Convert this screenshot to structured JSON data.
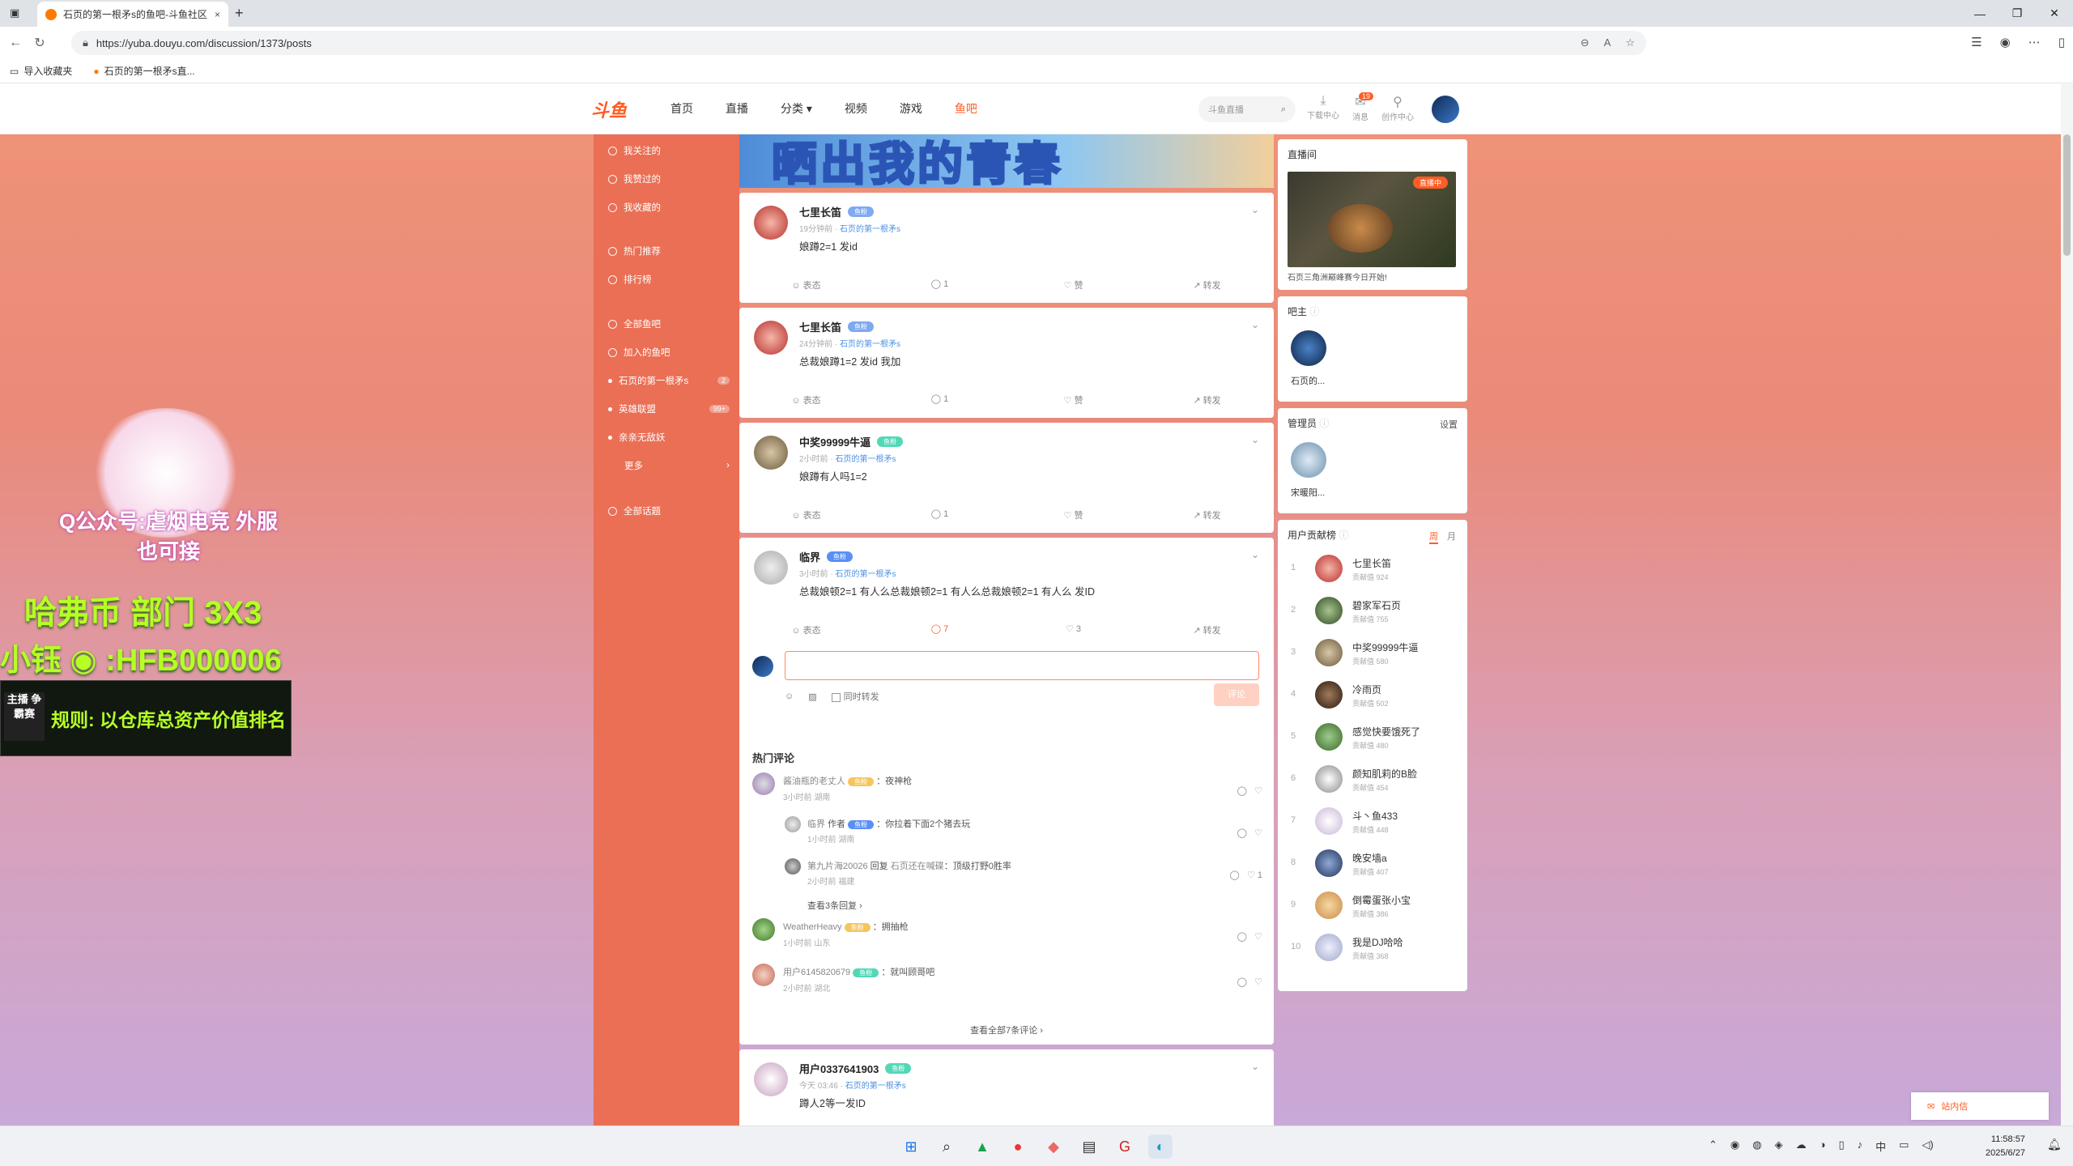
{
  "browser": {
    "tab_title": "石页的第一根矛s的鱼吧-斗鱼社区",
    "tab_close": "×",
    "new_tab": "+",
    "url": "https://yuba.douyu.com/discussion/1373/posts",
    "bookmarks": [
      "导入收藏夹",
      "石页的第一根矛s直..."
    ]
  },
  "topnav": {
    "logo": "斗鱼",
    "links": [
      "首页",
      "直播",
      "分类",
      "视频",
      "游戏",
      "鱼吧"
    ],
    "search_placeholder": "斗鱼直播",
    "icons": [
      {
        "icon": "download-icon",
        "label": "下载中心"
      },
      {
        "icon": "message-icon",
        "label": "消息",
        "badge": "19"
      },
      {
        "icon": "creator-icon",
        "label": "创作中心"
      }
    ]
  },
  "sidebar": {
    "items": [
      {
        "icon": "home-icon",
        "label": "我关注的"
      },
      {
        "icon": "like-icon",
        "label": "我赞过的"
      },
      {
        "icon": "star-icon",
        "label": "我收藏的"
      },
      {
        "icon": "fire-icon",
        "label": "热门推荐"
      },
      {
        "icon": "trophy-icon",
        "label": "排行榜"
      },
      {
        "icon": "grid-icon",
        "label": "全部鱼吧"
      },
      {
        "icon": "join-icon",
        "label": "加入的鱼吧"
      },
      {
        "label": "石页的第一根矛s",
        "count": "2"
      },
      {
        "label": "英雄联盟",
        "count": "99+"
      },
      {
        "label": "亲亲无敌妖"
      },
      {
        "label": "更多",
        "chevron": "›"
      },
      {
        "icon": "topic-icon",
        "label": "全部话题"
      }
    ]
  },
  "banner": {
    "text": "晒出我的青春"
  },
  "posts": [
    {
      "author": "七里长笛",
      "badge": "鱼粉",
      "time": "19分钟前",
      "forum": "石页的第一根矛s",
      "text": "娘蹲2=1 发id",
      "actions": {
        "react": "表态",
        "comments": "1",
        "like": "赞",
        "share": "转发"
      }
    },
    {
      "author": "七里长笛",
      "badge": "鱼粉",
      "time": "24分钟前",
      "forum": "石页的第一根矛s",
      "text": "总裁娘蹲1=2  发id 我加",
      "actions": {
        "react": "表态",
        "comments": "1",
        "like": "赞",
        "share": "转发"
      }
    },
    {
      "author": "中奖99999牛逼",
      "badge": "鱼粉",
      "time": "2小时前",
      "forum": "石页的第一根矛s",
      "text": "娘蹲有人吗1=2",
      "actions": {
        "react": "表态",
        "comments": "1",
        "like": "赞",
        "share": "转发"
      }
    },
    {
      "author": "临界",
      "badge": "鱼粉",
      "time": "3小时前",
      "forum": "石页的第一根矛s",
      "text": "总裁娘顿2=1 有人么总裁娘顿2=1 有人么总裁娘顿2=1 有人么  发ID",
      "actions": {
        "react": "表态",
        "comments": "7",
        "like": "3",
        "share": "转发"
      }
    },
    {
      "author": "用户0337641903",
      "badge": "鱼粉",
      "time": "今天 03:46",
      "forum": "石页的第一根矛s",
      "text": "蹲人2等一发ID"
    }
  ],
  "comment_box": {
    "emoji_icon": "☺",
    "image_icon": "▨",
    "repost_label": "同时转发",
    "submit_label": "评论"
  },
  "hot_comments": {
    "title": "热门评论",
    "items": [
      {
        "user": "酱油瓶的老丈人",
        "badge": "鱼粉",
        "text": "：夜神枪",
        "time": "3小时前",
        "location": "湖南",
        "likes": ""
      },
      {
        "user": "临界",
        "role": "作者",
        "badge": "鱼粉",
        "text": "：你拉着下面2个猪去玩",
        "time": "1小时前",
        "location": "湖南",
        "likes": ""
      },
      {
        "user": "第九片海20026",
        "reply": "回复",
        "reply_to": "石页还在喊碟",
        "text": "：顶级打野0胜率",
        "time": "2小时前",
        "location": "福建",
        "likes": "1"
      },
      {
        "see_replies": "查看3条回复 ›"
      },
      {
        "user": "WeatherHeavy",
        "badge": "鱼粉",
        "text": "：拥抽枪",
        "time": "1小时前",
        "location": "山东",
        "likes": ""
      },
      {
        "user": "用户6145820679",
        "badge": "鱼粉",
        "text": "：就叫顾哥吧",
        "time": "2小时前",
        "location": "湖北",
        "likes": ""
      }
    ],
    "see_all": "查看全部7条评论 ›"
  },
  "right": {
    "live_card": {
      "title": "直播间",
      "live_badge": "直播中",
      "caption": "石页三角洲巅峰赛今日开始!"
    },
    "owner_card": {
      "title": "吧主",
      "name": "石页的..."
    },
    "admin_card": {
      "title": "管理员",
      "settings": "设置",
      "name": "宋暖阳..."
    },
    "ranking": {
      "title": "用户贡献榜",
      "tabs": [
        "周",
        "月"
      ],
      "label": "贡献值",
      "rows": [
        {
          "rank": "1",
          "name": "七里长笛",
          "score": "924"
        },
        {
          "rank": "2",
          "name": "碧家军石页",
          "score": "755"
        },
        {
          "rank": "3",
          "name": "中奖99999牛逼",
          "score": "580"
        },
        {
          "rank": "4",
          "name": "冷雨页",
          "score": "502"
        },
        {
          "rank": "5",
          "name": "感觉快要饿死了",
          "score": "480"
        },
        {
          "rank": "6",
          "name": "颜知肌莉的B脸",
          "score": "454"
        },
        {
          "rank": "7",
          "name": "斗丶鱼433",
          "score": "448"
        },
        {
          "rank": "8",
          "name": "晚安墙a",
          "score": "407"
        },
        {
          "rank": "9",
          "name": "倒霉蛋张小宝",
          "score": "386"
        },
        {
          "rank": "10",
          "name": "我是DJ哈哈",
          "score": "368"
        }
      ]
    }
  },
  "promo": {
    "line1": "Q公众号:虐烟电竞 外服也可接",
    "line2": "哈弗币 部门 3X3",
    "line3": "小钰 ◉ :HFB000006",
    "line4_label": "主播 争霸赛",
    "line4": "规则: 以仓库总资产价值排名"
  },
  "notice": {
    "label": "站内信"
  },
  "taskbar": {
    "time": "11:58:57",
    "date": "2025/6/27",
    "ime": "中"
  },
  "colors": {
    "accent": "#ff5d23",
    "sidebar": "#ea6f55"
  }
}
